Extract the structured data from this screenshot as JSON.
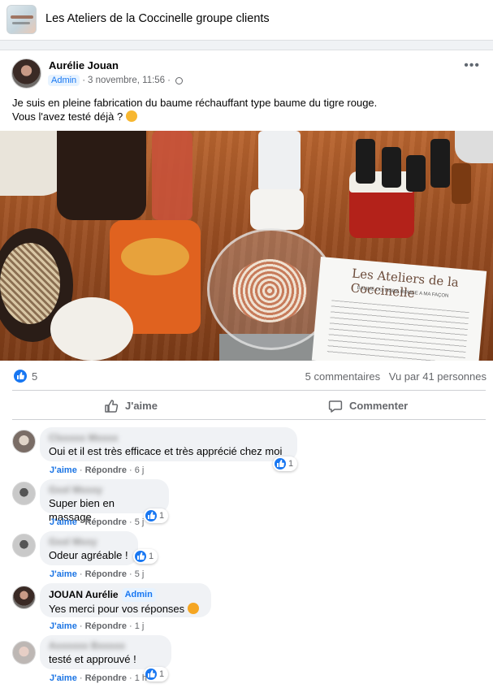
{
  "group": {
    "title": "Les Ateliers de la Coccinelle groupe clients"
  },
  "post": {
    "author": "Aurélie Jouan",
    "badge": "Admin",
    "date": "3 novembre, 11:56",
    "text_line1": "Je suis en pleine fabrication du baume réchauffant type baume du tigre rouge.",
    "text_line2": "Vous l'avez testé déjà ?",
    "photo_leaflet_title": "Les Ateliers de la Coccinelle",
    "photo_leaflet_subtitle": "BAUME DU TIGRE ROUGE A MA FAÇON",
    "reactions_count": "5",
    "comments_count": "5 commentaires",
    "views": "Vu par 41 personnes",
    "like_label": "J'aime",
    "comment_label": "Commenter",
    "accent_color": "#1877f2"
  },
  "comments": [
    {
      "author": "",
      "badge": "",
      "text": "Oui et il est très efficace et très apprécié chez moi",
      "like": "J'aime",
      "reply": "Répondre",
      "time": "6 j",
      "reactions": "1"
    },
    {
      "author": "",
      "badge": "",
      "text": "Super bien en massage",
      "like": "J'aime",
      "reply": "Répondre",
      "time": "5 j",
      "reactions": "1"
    },
    {
      "author": "",
      "badge": "",
      "text": "Odeur agréable !",
      "like": "J'aime",
      "reply": "Répondre",
      "time": "5 j",
      "reactions": "1"
    },
    {
      "author": "JOUAN Aurélie",
      "badge": "Admin",
      "text": "Yes merci pour vos réponses",
      "like": "J'aime",
      "reply": "Répondre",
      "time": "1 j",
      "reactions": ""
    },
    {
      "author": "",
      "badge": "",
      "text": "testé et approuvé !",
      "like": "J'aime",
      "reply": "Répondre",
      "time": "1 h",
      "reactions": "1"
    }
  ],
  "icons": {
    "more": "more-options-icon",
    "globe": "globe-icon",
    "like": "thumbs-up-icon",
    "comment": "comment-bubble-icon",
    "smile": "smiling-face-emoji",
    "hearts": "smiling-face-with-hearts-emoji"
  }
}
